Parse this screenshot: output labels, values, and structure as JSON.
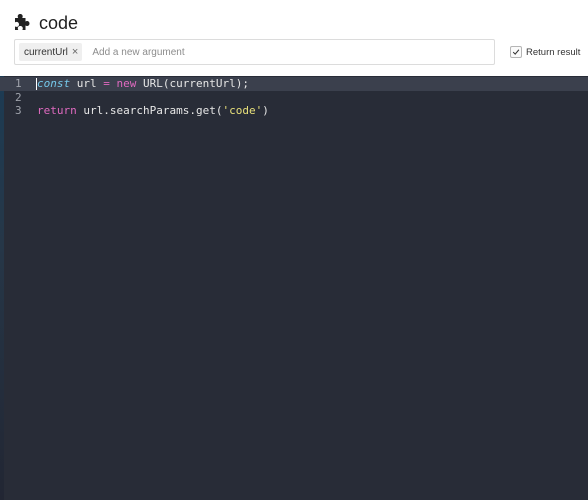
{
  "header": {
    "title": "code",
    "icon": "puzzle-icon"
  },
  "arguments": {
    "chips": [
      {
        "label": "currentUrl",
        "close": "×"
      }
    ],
    "placeholder": "Add a new argument"
  },
  "options": {
    "return_result_label": "Return result",
    "return_result_checked": true
  },
  "editor": {
    "lines": [
      {
        "number": "1",
        "tokens": [
          {
            "text": "const",
            "kind": "kw-const"
          },
          {
            "text": " url ",
            "kind": "plain"
          },
          {
            "text": "=",
            "kind": "op"
          },
          {
            "text": " ",
            "kind": "plain"
          },
          {
            "text": "new",
            "kind": "kw"
          },
          {
            "text": " URL(currentUrl);",
            "kind": "plain"
          }
        ]
      },
      {
        "number": "2",
        "tokens": []
      },
      {
        "number": "3",
        "tokens": [
          {
            "text": "return",
            "kind": "kw"
          },
          {
            "text": " url.searchParams.get(",
            "kind": "plain"
          },
          {
            "text": "'code'",
            "kind": "str"
          },
          {
            "text": ")",
            "kind": "plain"
          }
        ]
      }
    ]
  },
  "colors": {
    "editor_bg": "#282c37",
    "active_line": "#3b404d",
    "keyword": "#e06ac0",
    "const_keyword": "#75c8ea",
    "string": "#e8e07a"
  }
}
